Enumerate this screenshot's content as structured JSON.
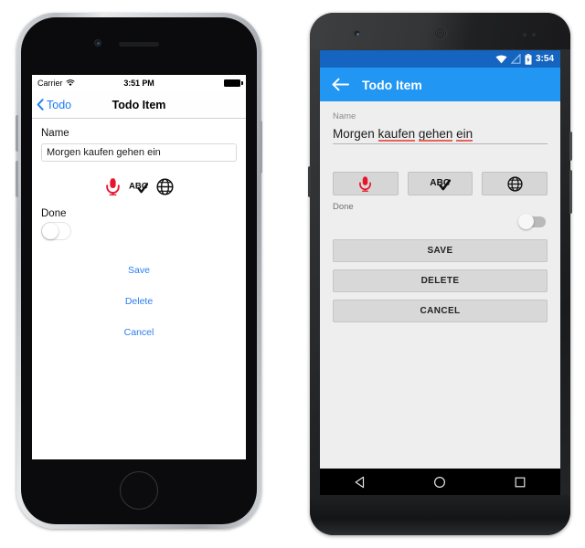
{
  "ios": {
    "status": {
      "carrier": "Carrier",
      "time": "3:51 PM",
      "wifi_icon": "wifi-icon",
      "battery_icon": "battery-icon"
    },
    "nav": {
      "back_label": "Todo",
      "back_icon": "chevron-left-icon",
      "title": "Todo Item"
    },
    "form": {
      "name_label": "Name",
      "name_value": "Morgen kaufen gehen ein",
      "name_placeholder": "Name",
      "done_label": "Done",
      "done_state": "off"
    },
    "icon_row": [
      {
        "name": "microphone-icon",
        "color": "#e8142c"
      },
      {
        "name": "spellcheck-abc-icon",
        "color": "#000000"
      },
      {
        "name": "globe-icon",
        "color": "#000000"
      }
    ],
    "actions": [
      {
        "label": "Save",
        "name": "save-button"
      },
      {
        "label": "Delete",
        "name": "delete-button"
      },
      {
        "label": "Cancel",
        "name": "cancel-button"
      }
    ],
    "accent_color": "#2a7df0"
  },
  "android": {
    "status": {
      "time": "3:54",
      "wifi_icon": "wifi-icon",
      "signal_icon": "signal-off-icon",
      "battery_icon": "battery-charging-icon",
      "bg_color": "#1565c0"
    },
    "toolbar": {
      "back_icon": "arrow-back-icon",
      "title": "Todo Item",
      "bg_color": "#2196f3"
    },
    "form": {
      "name_label": "Name",
      "name_words": [
        {
          "text": "Morgen",
          "misspelled": false
        },
        {
          "text": "kaufen",
          "misspelled": true
        },
        {
          "text": "gehen",
          "misspelled": true
        },
        {
          "text": "ein",
          "misspelled": true
        }
      ],
      "name_value": "Morgen kaufen gehen ein",
      "done_label": "Done",
      "done_state": "off"
    },
    "icon_row": [
      {
        "name": "microphone-icon",
        "color": "#e8142c"
      },
      {
        "name": "spellcheck-abc-icon",
        "color": "#000000"
      },
      {
        "name": "globe-icon",
        "color": "#000000"
      }
    ],
    "actions": [
      {
        "label": "SAVE",
        "name": "save-button"
      },
      {
        "label": "DELETE",
        "name": "delete-button"
      },
      {
        "label": "CANCEL",
        "name": "cancel-button"
      }
    ],
    "navbar": [
      {
        "name": "nav-back-icon"
      },
      {
        "name": "nav-home-icon"
      },
      {
        "name": "nav-recents-icon"
      }
    ],
    "spellcheck_underline_color": "#e8625d"
  }
}
